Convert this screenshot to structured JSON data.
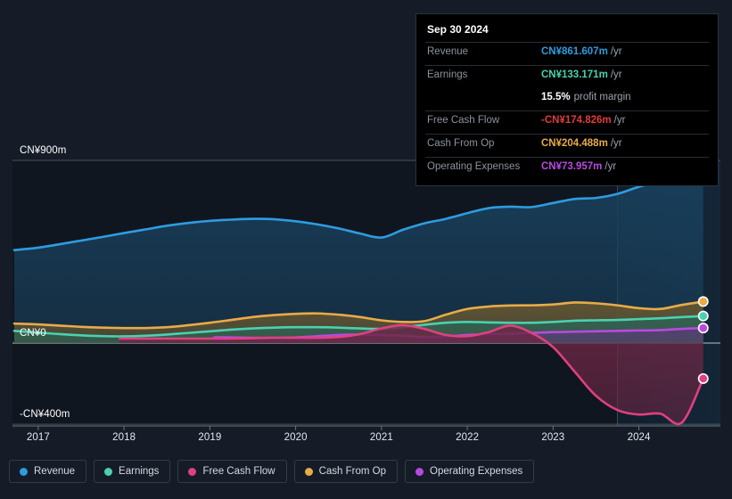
{
  "chart_data": {
    "type": "area",
    "title": "",
    "xlabel": "",
    "ylabel": "",
    "currency": "CN¥",
    "grid": true,
    "legend_position": "bottom",
    "ylim": [
      -400,
      900
    ],
    "y_ticks": [
      {
        "label": "CN¥900m",
        "value": 900
      },
      {
        "label": "CN¥0",
        "value": 0
      },
      {
        "label": "-CN¥400m",
        "value": -400
      }
    ],
    "x_ticks": [
      "2017",
      "2018",
      "2019",
      "2020",
      "2021",
      "2022",
      "2023",
      "2024"
    ],
    "x_range": [
      2016.7,
      2024.95
    ],
    "forecast_divider_x": 2023.75,
    "series": [
      {
        "name": "Revenue",
        "color": "#2e9ce0",
        "fill": "#19405c",
        "x": [
          2016.72,
          2017.0,
          2017.25,
          2017.5,
          2017.75,
          2018.0,
          2018.25,
          2018.5,
          2018.75,
          2019.0,
          2019.25,
          2019.5,
          2019.75,
          2020.0,
          2020.25,
          2020.5,
          2020.75,
          2021.0,
          2021.25,
          2021.5,
          2021.75,
          2022.0,
          2022.25,
          2022.5,
          2022.75,
          2023.0,
          2023.25,
          2023.5,
          2023.75,
          2024.0,
          2024.25,
          2024.5,
          2024.75
        ],
        "values": [
          458,
          470,
          487,
          505,
          523,
          542,
          560,
          578,
          592,
          602,
          608,
          612,
          610,
          600,
          585,
          565,
          540,
          520,
          558,
          590,
          612,
          640,
          665,
          672,
          670,
          690,
          710,
          715,
          735,
          770,
          800,
          840,
          861.607
        ]
      },
      {
        "name": "Cash From Op",
        "color": "#e9ab48",
        "fill": "#6d5a2e",
        "x": [
          2016.72,
          2017.0,
          2017.25,
          2017.5,
          2017.75,
          2018.0,
          2018.25,
          2018.5,
          2018.75,
          2019.0,
          2019.25,
          2019.5,
          2019.75,
          2020.0,
          2020.25,
          2020.5,
          2020.75,
          2021.0,
          2021.25,
          2021.5,
          2021.75,
          2022.0,
          2022.25,
          2022.5,
          2022.75,
          2023.0,
          2023.25,
          2023.5,
          2023.75,
          2024.0,
          2024.25,
          2024.5,
          2024.75
        ],
        "values": [
          96,
          92,
          86,
          80,
          76,
          74,
          74,
          78,
          88,
          100,
          114,
          128,
          138,
          144,
          146,
          140,
          128,
          112,
          104,
          108,
          140,
          168,
          180,
          185,
          186,
          190,
          200,
          196,
          186,
          172,
          168,
          188,
          204.488
        ]
      },
      {
        "name": "Earnings",
        "color": "#4ad1b0",
        "fill": "#2b6456",
        "x": [
          2016.72,
          2017.0,
          2017.25,
          2017.5,
          2017.75,
          2018.0,
          2018.25,
          2018.5,
          2018.75,
          2019.0,
          2019.25,
          2019.5,
          2019.75,
          2020.0,
          2020.25,
          2020.5,
          2020.75,
          2021.0,
          2021.25,
          2021.5,
          2021.75,
          2022.0,
          2022.25,
          2022.5,
          2022.75,
          2023.0,
          2023.25,
          2023.5,
          2023.75,
          2024.0,
          2024.25,
          2024.5,
          2024.75
        ],
        "values": [
          60,
          52,
          44,
          38,
          34,
          33,
          36,
          42,
          50,
          58,
          66,
          72,
          76,
          78,
          78,
          76,
          72,
          70,
          78,
          90,
          100,
          104,
          102,
          100,
          100,
          104,
          110,
          112,
          114,
          118,
          122,
          128,
          133.171
        ]
      },
      {
        "name": "Operating Expenses",
        "color": "#b84ae0",
        "fill": "#5a3a78",
        "x": [
          2019.05,
          2019.25,
          2019.5,
          2019.75,
          2020.0,
          2020.25,
          2020.5,
          2020.75,
          2021.0,
          2021.25,
          2021.5,
          2021.75,
          2022.0,
          2022.25,
          2022.5,
          2022.75,
          2023.0,
          2023.25,
          2023.5,
          2023.75,
          2024.0,
          2024.25,
          2024.5,
          2024.75
        ],
        "values": [
          28,
          28,
          26,
          26,
          28,
          34,
          40,
          42,
          40,
          36,
          30,
          32,
          40,
          44,
          46,
          50,
          54,
          56,
          58,
          60,
          62,
          64,
          70,
          73.957
        ]
      },
      {
        "name": "Free Cash Flow",
        "color": "#e0407f",
        "fill": "#6b2744",
        "x": [
          2017.95,
          2018.25,
          2018.5,
          2018.75,
          2019.0,
          2019.25,
          2019.5,
          2019.75,
          2020.0,
          2020.25,
          2020.5,
          2020.75,
          2021.0,
          2021.25,
          2021.5,
          2021.75,
          2022.0,
          2022.25,
          2022.5,
          2022.75,
          2023.0,
          2023.25,
          2023.5,
          2023.75,
          2024.0,
          2024.25,
          2024.5,
          2024.75
        ],
        "values": [
          22,
          22,
          22,
          22,
          22,
          22,
          24,
          26,
          26,
          26,
          30,
          44,
          72,
          88,
          70,
          40,
          34,
          54,
          86,
          50,
          -20,
          -140,
          -260,
          -330,
          -352,
          -348,
          -392,
          -174.826
        ]
      }
    ]
  },
  "tooltip": {
    "date": "Sep 30 2024",
    "rows": [
      {
        "label": "Revenue",
        "value": "CN¥861.607m",
        "unit": "/yr",
        "color": "#2e9ce0"
      },
      {
        "label": "Earnings",
        "value": "CN¥133.171m",
        "unit": "/yr",
        "color": "#4ad1b0"
      },
      {
        "label": "",
        "value": "15.5%",
        "unit": "profit margin",
        "color": "#ffffff",
        "margin_row": true
      },
      {
        "label": "Free Cash Flow",
        "value": "-CN¥174.826m",
        "unit": "/yr",
        "color": "#e33b3b"
      },
      {
        "label": "Cash From Op",
        "value": "CN¥204.488m",
        "unit": "/yr",
        "color": "#e9ab48"
      },
      {
        "label": "Operating Expenses",
        "value": "CN¥73.957m",
        "unit": "/yr",
        "color": "#b84ae0"
      }
    ]
  },
  "legend": {
    "items": [
      {
        "label": "Revenue",
        "color": "#2e9ce0"
      },
      {
        "label": "Earnings",
        "color": "#4ad1b0"
      },
      {
        "label": "Free Cash Flow",
        "color": "#e0407f"
      },
      {
        "label": "Cash From Op",
        "color": "#e9ab48"
      },
      {
        "label": "Operating Expenses",
        "color": "#b84ae0"
      }
    ]
  }
}
